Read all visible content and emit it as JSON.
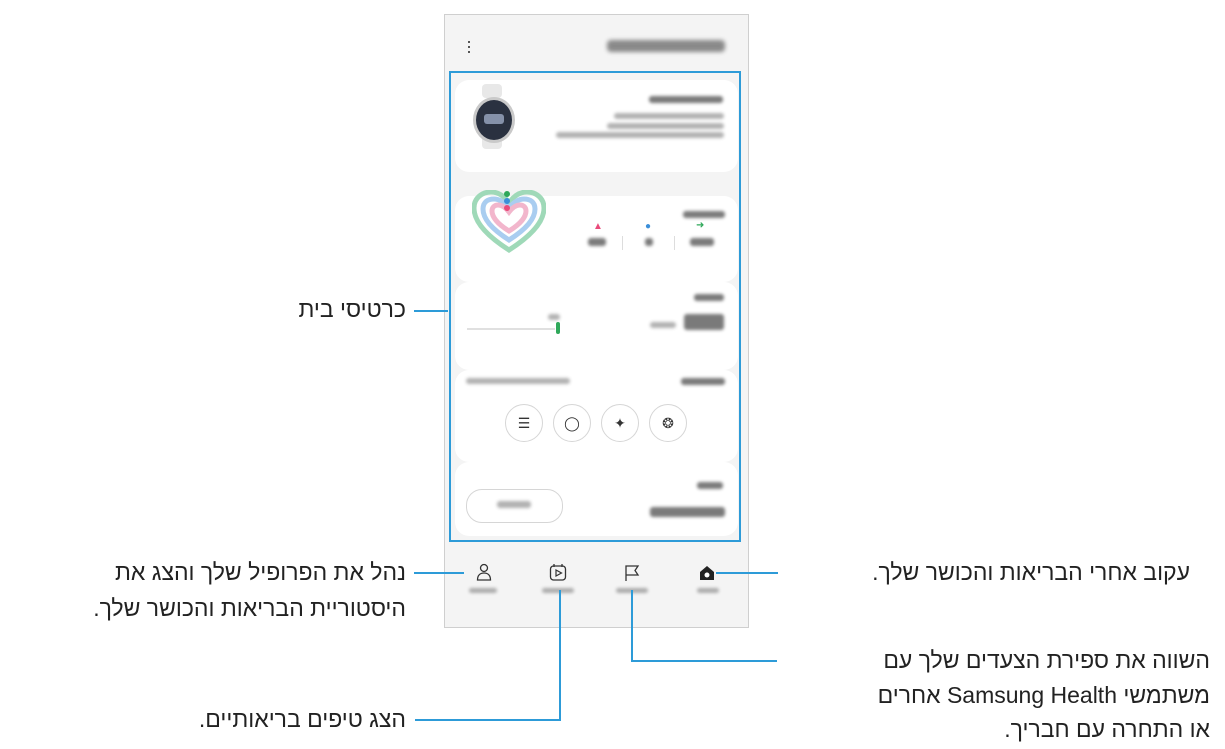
{
  "callouts": {
    "home_cards": "כרטיסי בית",
    "track_health": "עקוב אחרי הבריאות והכושר שלך.",
    "profile_line1": "נהל את הפרופיל שלך והצג את",
    "profile_line2": "היסטוריית הבריאות והכושר שלך.",
    "compare_line1": "השווה את ספירת הצעדים שלך עם",
    "compare_line2": "משתמשי Samsung Health אחרים",
    "compare_line3": "או התחרה עם חבריך.",
    "tips": "הצג טיפים בריאותיים."
  },
  "colors": {
    "highlight_frame": "#2d9bd8",
    "accent_green": "#2fa85a",
    "callout_line": "#2d9bd8"
  },
  "icons": {
    "menu": "kebab-icon",
    "nav": [
      "home-icon",
      "together-flag-icon",
      "discover-icon",
      "profile-icon"
    ],
    "exercise": [
      "walking-icon",
      "running-icon",
      "cycling-icon",
      "list-icon"
    ]
  }
}
